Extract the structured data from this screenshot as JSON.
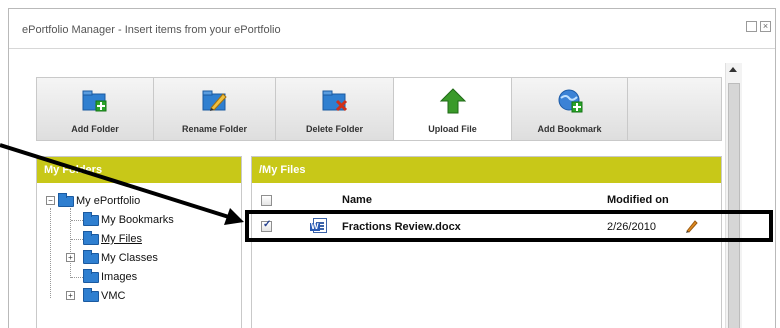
{
  "window": {
    "title": "ePortfolio Manager - Insert items from your ePortfolio",
    "max_glyph": "",
    "close_glyph": "×"
  },
  "toolbar": {
    "buttons": [
      {
        "label": "Add Folder",
        "icon": "add-folder-icon"
      },
      {
        "label": "Rename Folder",
        "icon": "rename-folder-icon"
      },
      {
        "label": "Delete Folder",
        "icon": "delete-folder-icon"
      },
      {
        "label": "Upload File",
        "icon": "upload-arrow-icon",
        "active": true
      },
      {
        "label": "Add Bookmark",
        "icon": "globe-bookmark-icon"
      }
    ]
  },
  "folders_panel": {
    "title": "My Folders",
    "tree": [
      {
        "label": "My ePortfolio",
        "expander": "−"
      },
      {
        "label": "My Bookmarks"
      },
      {
        "label": "My Files",
        "selected": true
      },
      {
        "label": "My Classes",
        "expander": "+"
      },
      {
        "label": "Images"
      },
      {
        "label": "VMC",
        "expander": "+"
      }
    ]
  },
  "files_panel": {
    "title": "/My Files",
    "columns": {
      "name": "Name",
      "modified": "Modified on"
    },
    "rows": [
      {
        "name": "Fractions Review.docx",
        "modified": "2/26/2010",
        "checked": true
      }
    ]
  },
  "colors": {
    "panel_header": "#c8c818",
    "folder_blue": "#2f7fd0",
    "annotation": "#000000"
  }
}
